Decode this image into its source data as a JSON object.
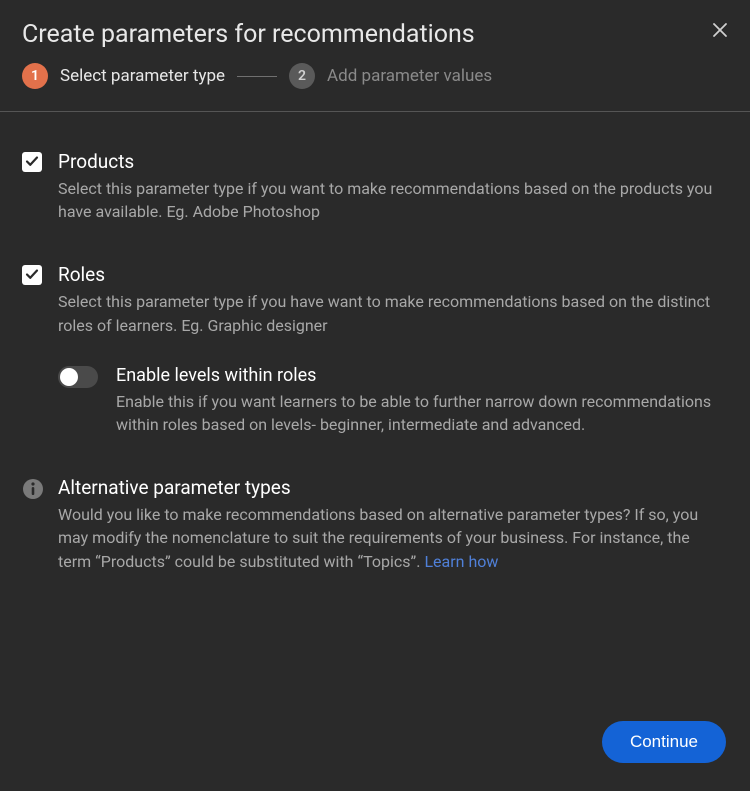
{
  "header": {
    "title": "Create parameters for recommendations"
  },
  "stepper": {
    "step1_num": "1",
    "step1_label": "Select parameter type",
    "step2_num": "2",
    "step2_label": "Add parameter values"
  },
  "options": {
    "products": {
      "title": "Products",
      "desc": "Select this parameter type if you want to make recommendations based on the products you have available. Eg.  Adobe Photoshop"
    },
    "roles": {
      "title": "Roles",
      "desc": "Select this parameter type if you have want to make recommendations based on the distinct roles of learners. Eg. Graphic designer",
      "levels_title": "Enable levels within roles",
      "levels_desc": "Enable this if you want learners to be able to further narrow down recommendations within roles based on levels- beginner, intermediate and advanced."
    },
    "alt": {
      "title": "Alternative parameter types",
      "desc": "Would you like to make recommendations based on alternative parameter types? If so, you may modify the nomenclature to suit the requirements of your business. For instance, the term “Products” could be substituted with “Topics”. ",
      "link": "Learn how"
    }
  },
  "footer": {
    "continue_label": "Continue"
  }
}
